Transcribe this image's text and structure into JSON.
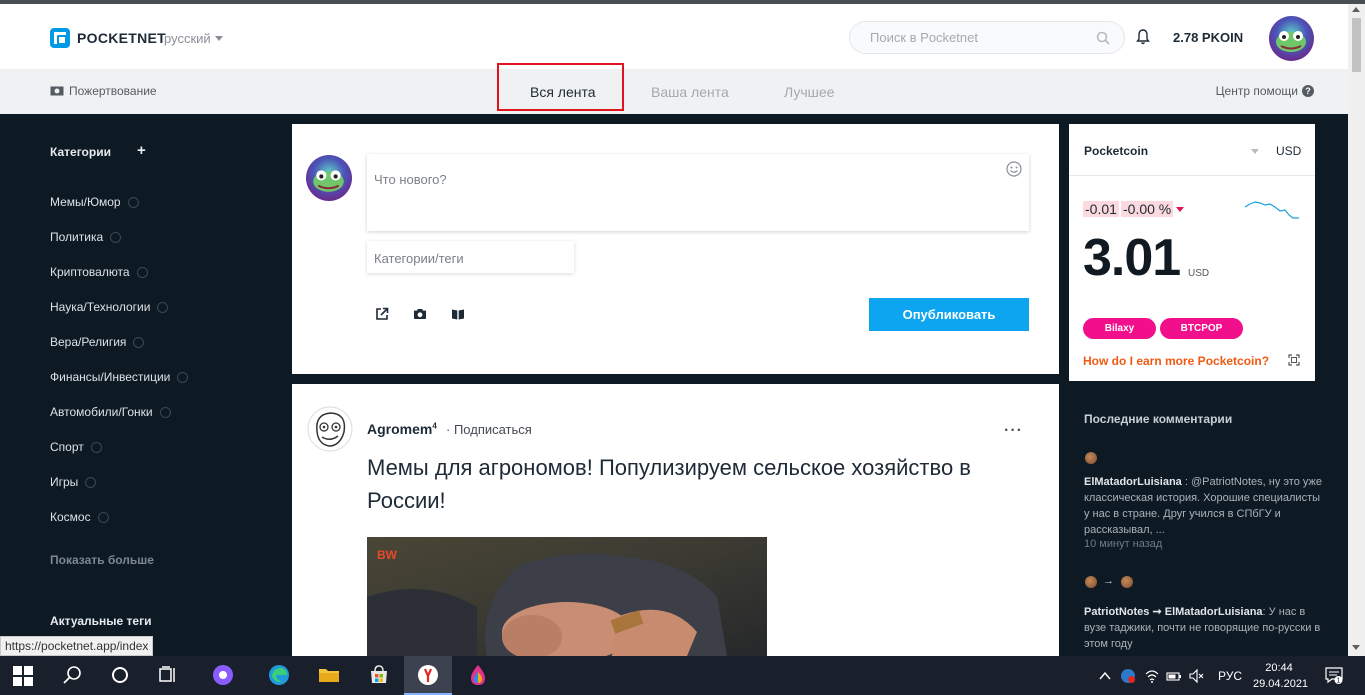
{
  "header": {
    "logo_text": "POCKETNET",
    "language": "русский",
    "search_placeholder": "Поиск в Pocketnet",
    "balance": "2.78 PKOIN"
  },
  "subnav": {
    "donate": "Пожертвование",
    "tabs": [
      {
        "label": "Вся лента",
        "active": true
      },
      {
        "label": "Ваша лента",
        "active": false
      },
      {
        "label": "Лучшее",
        "active": false
      }
    ],
    "help": "Центр помощи",
    "help_icon": "?"
  },
  "sidebar": {
    "categories_title": "Категории",
    "add_symbol": "+",
    "categories": [
      "Мемы/Юмор",
      "Политика",
      "Криптовалюта",
      "Наука/Технологии",
      "Вера/Религия",
      "Финансы/Инвестиции",
      "Автомобили/Гонки",
      "Спорт",
      "Игры",
      "Космос"
    ],
    "show_more": "Показать больше",
    "tags_title": "Актуальные теги"
  },
  "composer": {
    "text_placeholder": "Что нового?",
    "tags_placeholder": "Категории/теги",
    "publish_label": "Опубликовать"
  },
  "post": {
    "author": "Agromem",
    "author_rep": "4",
    "subscribe": "· Подписаться",
    "more": "···",
    "title": "Мемы для агрономов! Популизируем сельское хозяйство в России!",
    "image_logo": "BW"
  },
  "coin": {
    "name": "Pocketcoin",
    "currency": "USD",
    "change_abs": "-0.01",
    "change_pct": "-0.00 %",
    "price": "3.01",
    "price_currency": "USD",
    "exchanges": [
      "Bilaxy",
      "BTCPOP"
    ],
    "earn_link": "How do I earn more Pocketcoin?",
    "accent_color": "#f10f8c",
    "link_color": "#f05a12"
  },
  "recent_comments": {
    "title": "Последние комментарии",
    "arrow": "→",
    "items": [
      {
        "author": "ElMatadorLuisiana",
        "text": " : @PatriotNotes, ну это уже классическая история. Хорошие специалисты у нас в стране. Друг учился в СПбГУ и рассказывал, ...",
        "time": "10 минут назад"
      },
      {
        "author": "PatriotNotes ➞ ElMatadorLuisiana",
        "text": ": У нас в вузе таджики, почти не говорящие по-русски в этом году"
      }
    ]
  },
  "status_url": "https://pocketnet.app/index",
  "taskbar": {
    "lang": "РУС",
    "time": "20:44",
    "date": "29.04.2021",
    "notif_count": "1"
  }
}
